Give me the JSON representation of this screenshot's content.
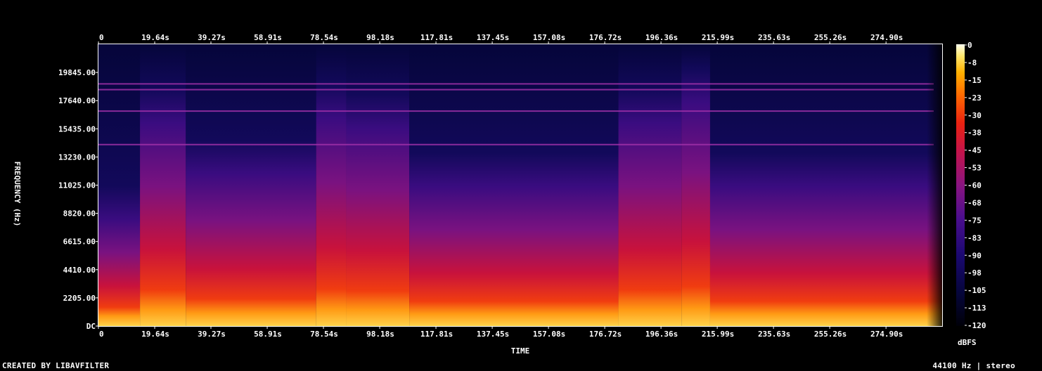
{
  "chart_data": {
    "type": "heatmap",
    "xlabel": "TIME",
    "ylabel": "FREQUENCY (Hz)",
    "x_ticks": [
      "0",
      "19.64s",
      "39.27s",
      "58.91s",
      "78.54s",
      "98.18s",
      "117.81s",
      "137.45s",
      "157.08s",
      "176.72s",
      "196.36s",
      "215.99s",
      "235.63s",
      "255.26s",
      "274.90s"
    ],
    "x_tick_values_s": [
      0,
      19.64,
      39.27,
      58.91,
      78.54,
      98.18,
      117.81,
      137.45,
      157.08,
      176.72,
      196.36,
      215.99,
      235.63,
      255.26,
      274.9
    ],
    "xlim_s": [
      0,
      294.5
    ],
    "y_ticks": [
      "DC",
      "2205.00",
      "4410.00",
      "6615.00",
      "8820.00",
      "11025.00",
      "13230.00",
      "15435.00",
      "17640.00",
      "19845.00"
    ],
    "y_tick_values_hz": [
      0,
      2205,
      4410,
      6615,
      8820,
      11025,
      13230,
      15435,
      17640,
      19845
    ],
    "ylim_hz": [
      0,
      22050
    ],
    "colorbar": {
      "label": "dBFS",
      "ticks": [
        "0",
        "-8",
        "-15",
        "-23",
        "-30",
        "-38",
        "-45",
        "-53",
        "-60",
        "-68",
        "-75",
        "-83",
        "-90",
        "-98",
        "-105",
        "-113",
        "-120"
      ],
      "range_db": [
        -120,
        0
      ]
    },
    "sections": [
      {
        "start_s": 0,
        "end_s": 14.5,
        "level": 0.42
      },
      {
        "start_s": 14.5,
        "end_s": 30.5,
        "level": 0.8
      },
      {
        "start_s": 30.5,
        "end_s": 76,
        "level": 0.6
      },
      {
        "start_s": 76,
        "end_s": 86.5,
        "level": 0.82
      },
      {
        "start_s": 86.5,
        "end_s": 108.5,
        "level": 0.78
      },
      {
        "start_s": 108.5,
        "end_s": 181.5,
        "level": 0.55
      },
      {
        "start_s": 181.5,
        "end_s": 203.5,
        "level": 0.8
      },
      {
        "start_s": 203.5,
        "end_s": 213.5,
        "level": 0.88
      },
      {
        "start_s": 213.5,
        "end_s": 294.5,
        "level": 0.55
      }
    ],
    "tonal_lines_hz": [
      18950,
      18500,
      16820,
      14200
    ]
  },
  "footer": {
    "left": "CREATED BY LIBAVFILTER",
    "right": "44100 Hz | stereo"
  },
  "colors": {
    "background": "#000000",
    "text": "#ffffff",
    "axis": "#ffffff"
  }
}
